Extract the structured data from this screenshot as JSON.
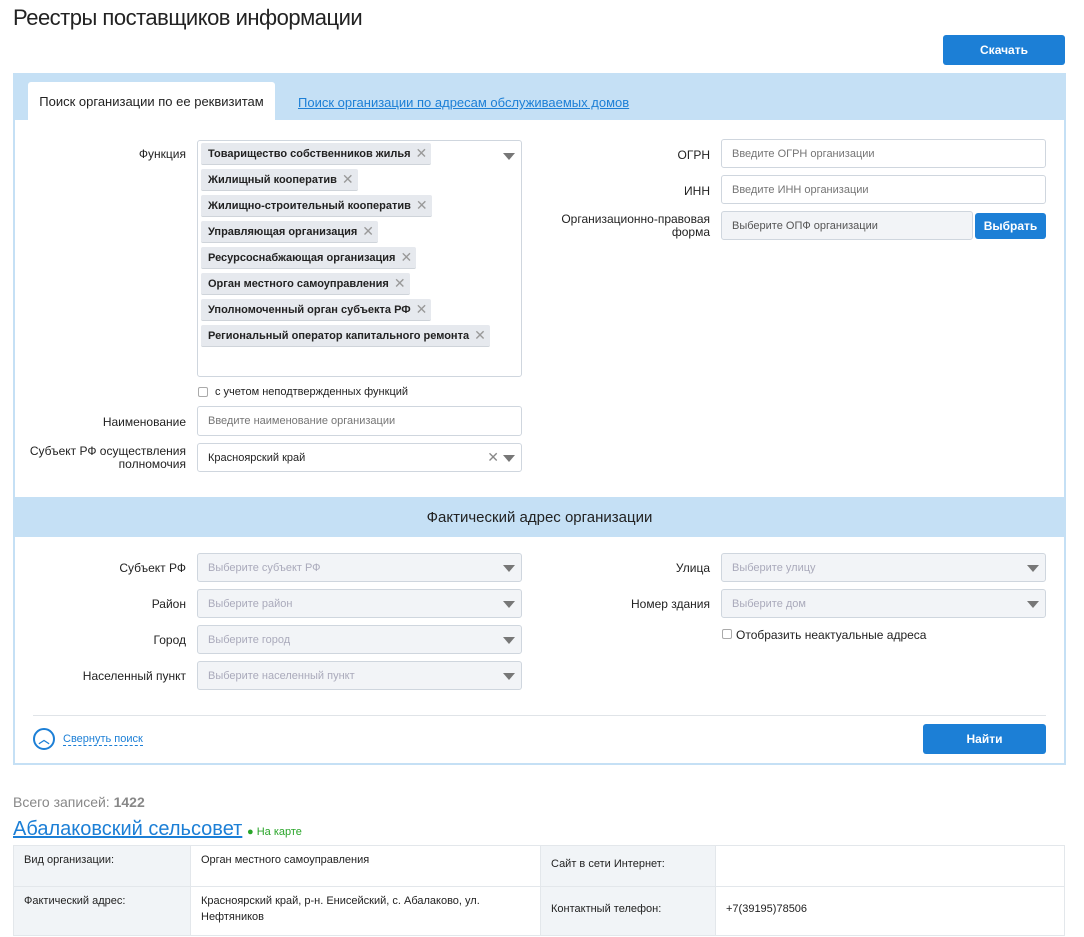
{
  "page_title": "Реестры поставщиков информации",
  "download_label": "Скачать",
  "tabs": [
    "Поиск организации по ее реквизитам",
    "Поиск организации по адресам обслуживаемых домов"
  ],
  "form": {
    "function_label": "Функция",
    "function_tags": [
      "Товарищество собственников жилья",
      "Жилищный кооператив",
      "Жилищно-строительный кооператив",
      "Управляющая организация",
      "Ресурсоснабжающая организация",
      "Орган местного самоуправления",
      "Уполномоченный орган субъекта РФ",
      "Региональный оператор капитального ремонта"
    ],
    "unconfirmed_label": "с учетом неподтвержденных функций",
    "name_label": "Наименование",
    "name_placeholder": "Введите наименование организации",
    "subject_label": "Субъект РФ осуществления полномочия",
    "subject_value": "Красноярский край",
    "ogrn_label": "ОГРН",
    "ogrn_placeholder": "Введите ОГРН организации",
    "inn_label": "ИНН",
    "inn_placeholder": "Введите ИНН организации",
    "opf_label": "Организационно-правовая форма",
    "opf_placeholder": "Выберите ОПФ организации",
    "opf_button": "Выбрать"
  },
  "address": {
    "section_title": "Фактический адрес организации",
    "region_label": "Субъект РФ",
    "region_placeholder": "Выберите субъект РФ",
    "district_label": "Район",
    "district_placeholder": "Выберите район",
    "city_label": "Город",
    "city_placeholder": "Выберите город",
    "settlement_label": "Населенный пункт",
    "settlement_placeholder": "Выберите населенный пункт",
    "street_label": "Улица",
    "street_placeholder": "Выберите улицу",
    "building_label": "Номер здания",
    "building_placeholder": "Выберите дом",
    "show_outdated_label": "Отобразить неактуальные адреса"
  },
  "collapse_label": "Свернуть поиск",
  "find_label": "Найти",
  "results": {
    "total_label": "Всего записей:",
    "total": "1422",
    "org_name": "Абалаковский сельсовет",
    "map_label": "На карте",
    "type_label": "Вид организации:",
    "type_value": "Орган местного самоуправления",
    "address_label": "Фактический адрес:",
    "address_value": "Красноярский край, р-н. Енисейский, с. Абалаково, ул. Нефтяников",
    "site_label": "Сайт в сети Интернет:",
    "site_value": "",
    "phone_label": "Контактный телефон:",
    "phone_value": "+7(39195)78506"
  },
  "colors": {
    "accent": "#1c7fd6",
    "panel": "#c5e0f5",
    "map_green": "#2aa52a"
  }
}
